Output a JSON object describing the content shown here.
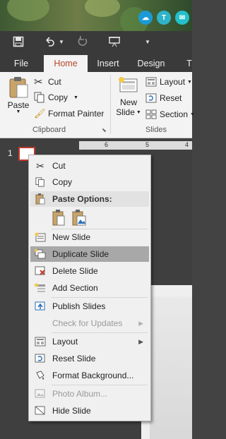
{
  "quick_access": {
    "icons": [
      "save-icon",
      "undo-icon",
      "redo-icon",
      "present-from-start-icon",
      "customize-qat-icon"
    ]
  },
  "tabs": [
    {
      "label": "File"
    },
    {
      "label": "Home",
      "active": true
    },
    {
      "label": "Insert"
    },
    {
      "label": "Design"
    },
    {
      "label": "T"
    }
  ],
  "ribbon": {
    "clipboard": {
      "paste": "Paste",
      "cut": "Cut",
      "copy": "Copy",
      "format_painter": "Format Painter",
      "group_label": "Clipboard"
    },
    "slides": {
      "new_slide_line1": "New",
      "new_slide_line2": "Slide",
      "layout": "Layout",
      "reset": "Reset",
      "section": "Section",
      "group_label": "Slides"
    }
  },
  "ruler": {
    "marks": [
      "6",
      "5",
      "4"
    ]
  },
  "thumbnail": {
    "number": "1"
  },
  "context_menu": {
    "items": [
      {
        "label": "Cut",
        "underline": "t",
        "icon": "scissors-icon",
        "enabled": true
      },
      {
        "label": "Copy",
        "icon": "copy-icon",
        "enabled": true
      },
      {
        "label": "Paste Options:",
        "icon": "paste-icon",
        "enabled": true
      },
      {
        "label": "New Slide",
        "icon": "new-slide-icon",
        "enabled": true
      },
      {
        "label": "Duplicate Slide",
        "icon": "duplicate-slide-icon",
        "enabled": true,
        "highlighted": true
      },
      {
        "label": "Delete Slide",
        "icon": "delete-slide-icon",
        "enabled": true
      },
      {
        "label": "Add Section",
        "icon": "add-section-icon",
        "enabled": true
      },
      {
        "label": "Publish Slides",
        "icon": "publish-slides-icon",
        "enabled": true
      },
      {
        "label": "Check for Updates",
        "icon": "",
        "enabled": false,
        "submenu": true
      },
      {
        "label": "Layout",
        "icon": "layout-icon",
        "enabled": true,
        "submenu": true
      },
      {
        "label": "Reset Slide",
        "icon": "reset-slide-icon",
        "enabled": true
      },
      {
        "label": "Format Background...",
        "icon": "format-background-icon",
        "enabled": true
      },
      {
        "label": "Photo Album...",
        "icon": "photo-album-icon",
        "enabled": false
      },
      {
        "label": "Hide Slide",
        "icon": "hide-slide-icon",
        "enabled": true
      }
    ]
  },
  "colors": {
    "accent": "#b7472a",
    "title_bar": "#3a3a3a",
    "ribbon": "#f3f3f3",
    "menu_highlight": "#a8a8a8"
  }
}
